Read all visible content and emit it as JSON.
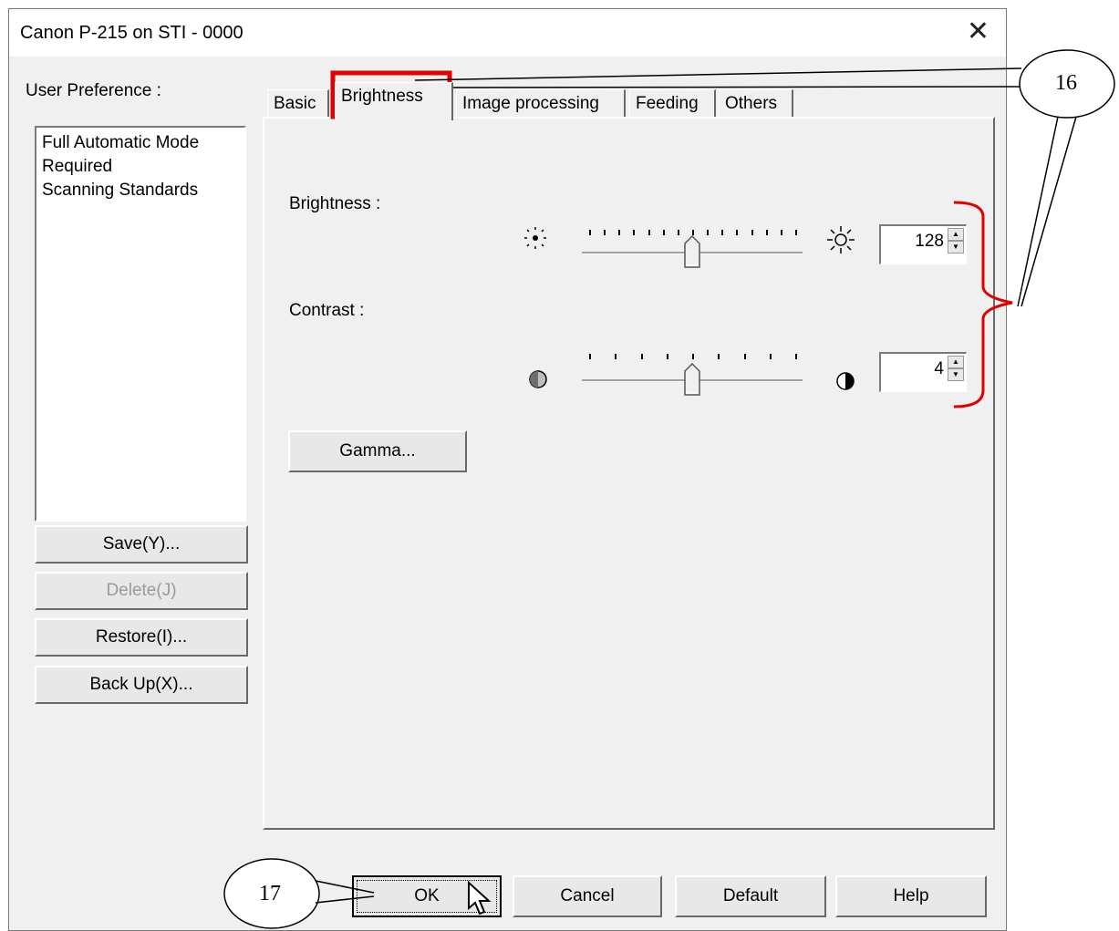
{
  "window": {
    "title": "Canon P-215 on STI - 0000",
    "close_glyph": "✕"
  },
  "user_preference": {
    "label": "User Preference :",
    "items": [
      "Full Automatic Mode",
      "Required",
      "Scanning Standards"
    ]
  },
  "left_buttons": {
    "save": "Save(Y)...",
    "delete": "Delete(J)",
    "restore": "Restore(I)...",
    "backup": "Back Up(X)..."
  },
  "tabs": [
    "Basic",
    "Brightness",
    "Image processing",
    "Feeding",
    "Others"
  ],
  "active_tab": "Brightness",
  "brightness": {
    "label": "Brightness :",
    "value": "128",
    "level": 0.5
  },
  "contrast": {
    "label": "Contrast :",
    "value": "4",
    "level": 0.5
  },
  "gamma_button": "Gamma...",
  "bottom_buttons": {
    "ok": "OK",
    "cancel": "Cancel",
    "default": "Default",
    "help": "Help"
  },
  "callouts": {
    "c16": "16",
    "c17": "17"
  },
  "colors": {
    "highlight": "#e00000",
    "dialog_bg": "#f0f0f0"
  }
}
